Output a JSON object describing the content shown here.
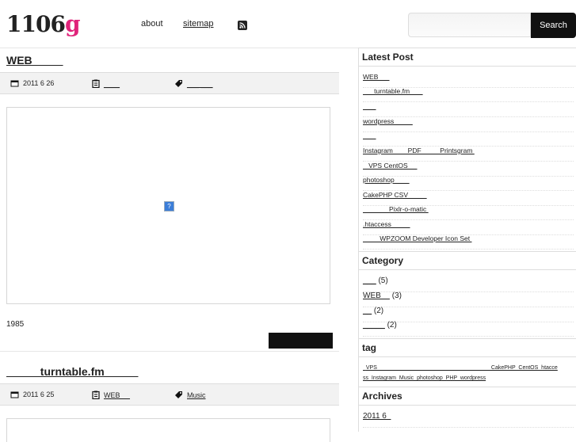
{
  "header": {
    "logo_main": "1106",
    "logo_accent": "g",
    "nav": [
      {
        "label": "about"
      },
      {
        "label": "sitemap"
      }
    ],
    "rss_icon": "rss-icon",
    "search": {
      "placeholder": "",
      "button": "Search"
    }
  },
  "posts": [
    {
      "title": "WEB          ",
      "date": "2011 6 26",
      "category": "____",
      "tags": "___ ___",
      "excerpt": "1985"
    },
    {
      "title": "           turntable.fm           ",
      "date": "2011 6 25",
      "category": "WEB     ",
      "tags": "Music"
    }
  ],
  "sidebar": {
    "latest_heading": "Latest Post",
    "latest": [
      "WEB      ",
      "      turntable.fm       ",
      "       ",
      "wordpress          ",
      "       ",
      "Instagram        PDF          Printsgram ",
      "   VPS CentOS     ",
      "photoshop        ",
      "CakePHP CSV          ",
      "              Pixlr-o-matic ",
      ".htaccess          ",
      "         WPZOOM Developer Icon Set "
    ],
    "category_heading": "Category",
    "categories": [
      {
        "name": "___",
        "count": "(5)"
      },
      {
        "name": "WEB    ",
        "count": "(3)"
      },
      {
        "name": "__",
        "count": "(2)"
      },
      {
        "name": "_____",
        "count": "(2)"
      }
    ],
    "tag_heading": "tag",
    "tag_line1": "  VPS   __   ___   ___   ___   __   ___   __   __   __   CakePHP  CentOS  htacce",
    "tag_line2": "ss  Instagram  Music  photoshop  PHP  wordpress",
    "archives_heading": "Archives",
    "archives": [
      "2011 6  "
    ]
  },
  "colors": {
    "accent": "#e0237a",
    "dark": "#111111",
    "meta_bg": "#f2f2f2"
  }
}
